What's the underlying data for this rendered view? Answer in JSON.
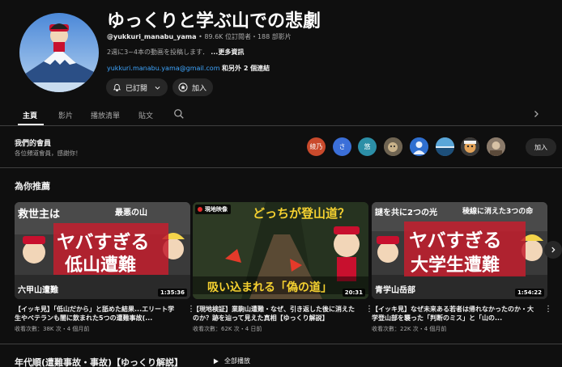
{
  "channel": {
    "name": "ゆっくりと学ぶ山での悲劇",
    "handle": "@yukkuri_manabu_yama",
    "stats": "89.6K 位訂閱者・188 部影片",
    "description": "2週に3~4本の動画を投稿します．",
    "more_label": "...更多資訊",
    "email": "yukkuri.manabu.yama@gmail.com",
    "other_links": "和另外 2 個連結",
    "subscribed_label": "已訂閱",
    "join_label": "加入"
  },
  "tabs": [
    {
      "label": "主頁",
      "active": true
    },
    {
      "label": "影片",
      "active": false
    },
    {
      "label": "播放清單",
      "active": false
    },
    {
      "label": "貼文",
      "active": false
    }
  ],
  "members": {
    "title": "我們的會員",
    "subtitle": "各位頻道會員，感謝你！",
    "join_label": "加入",
    "avatars": [
      {
        "text": "綾乃",
        "color": "#c94a2c"
      },
      {
        "text": "さ",
        "color": "#3b6fd8"
      },
      {
        "text": "悠",
        "color": "#2c8fa7"
      },
      {
        "text": "",
        "color": "#7a6a4e"
      },
      {
        "text": "",
        "color": "#2f6fd0"
      },
      {
        "text": "",
        "color": "#3a8fc0"
      },
      {
        "text": "",
        "color": "#a55a2a"
      },
      {
        "text": "",
        "color": "#8a7a6a"
      }
    ]
  },
  "recommended": {
    "title": "為你推薦",
    "videos": [
      {
        "title": "【イッキ見】「低山だから」と舐めた結果...エリート学生やベテランも闇に飲まれた5つの遭難事故(...",
        "meta": "收看次數：38K 次・4 個月前",
        "duration": "1:35:36",
        "thumb_big": "ヤバすぎる",
        "thumb_big2": "低山遭難",
        "thumb_top": "救世主は",
        "thumb_top2": "最悪の山",
        "thumb_bottom": "六甲山遭難"
      },
      {
        "title": "【現地検証】業駒山遭難・なぜ、引き返した後に消えたのか？跡を辿って見えた真相【ゆっくり解説】",
        "meta": "收看次數：62K 次・4 日前",
        "duration": "20:31",
        "live_badge": "現地映像",
        "thumb_top": "どっちが登山道？",
        "thumb_bottom": "吸い込まれる「偽の道」"
      },
      {
        "title": "【イッキ見】なぜ未来ある若者は帰れなかったのか・大学登山部を襲った「判断のミス」と「山の...",
        "meta": "收看次數：22K 次・4 個月前",
        "duration": "1:54:22",
        "thumb_big": "ヤバすぎる",
        "thumb_big2": "大学生遭難",
        "thumb_top": "謎を共に2つの光",
        "thumb_top2": "稜線に消えた3つの命",
        "thumb_bottom": "青学山岳部"
      }
    ]
  },
  "section2": {
    "title": "年代順(遭難事故・事故)【ゆっくり解説】",
    "play_all_label": "全部播放"
  }
}
